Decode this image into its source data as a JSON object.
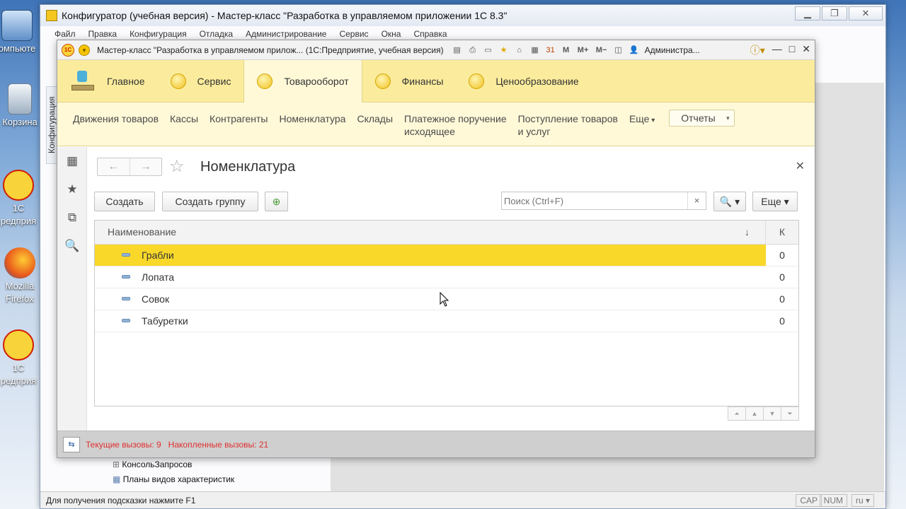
{
  "desktop": {
    "icons": [
      {
        "label": "омпьюте"
      },
      {
        "label": "Корзина"
      },
      {
        "label": "1С\nредприя"
      },
      {
        "label": "Mozilla Firefox"
      },
      {
        "label": "1С\nредприя"
      }
    ]
  },
  "configurator": {
    "title": "Конфигуратор (учебная версия) - Мастер-класс \"Разработка в управляемом приложении 1С 8.3\"",
    "menu": [
      "Файл",
      "Правка",
      "Конфигурация",
      "Отладка",
      "Администрирование",
      "Сервис",
      "Окна",
      "Справка"
    ],
    "side_tab": "Конфигурация",
    "tree": [
      "КонсольЗапросов",
      "Планы видов характеристик"
    ],
    "status_text": "Для получения подсказки нажмите F1",
    "indicators": {
      "cap": "CAP",
      "num": "NUM",
      "lang": "ru"
    }
  },
  "enterprise": {
    "title": "Мастер-класс \"Разработка в управляемом прилож...  (1С:Предприятие, учебная версия)",
    "user": "Администра...",
    "sections": [
      {
        "label": "Главное"
      },
      {
        "label": "Сервис"
      },
      {
        "label": "Товарооборот",
        "active": true
      },
      {
        "label": "Финансы"
      },
      {
        "label": "Ценообразование"
      }
    ],
    "commands": [
      {
        "label": "Движения товаров"
      },
      {
        "label": "Кассы"
      },
      {
        "label": "Контрагенты"
      },
      {
        "label": "Номенклатура"
      },
      {
        "label": "Склады"
      },
      {
        "label": "Платежное поручение\nисходящее"
      },
      {
        "label": "Поступление товаров\nи услуг"
      }
    ],
    "more_label": "Еще",
    "reports_label": "Отчеты",
    "form": {
      "title": "Номенклатура",
      "create_label": "Создать",
      "create_group_label": "Создать группу",
      "search_placeholder": "Поиск (Ctrl+F)",
      "more_label": "Еще",
      "columns": {
        "name": "Наименование",
        "code": "К"
      },
      "rows": [
        {
          "name": "Грабли",
          "code": "0",
          "selected": true
        },
        {
          "name": "Лопата",
          "code": "0"
        },
        {
          "name": "Совок",
          "code": "0"
        },
        {
          "name": "Табуретки",
          "code": "0"
        }
      ]
    },
    "status_calls": "Текущие вызовы: 9   Накопленные вызовы: 21"
  },
  "colors": {
    "sections_bg": "#fbec9d",
    "selected_row": "#f9d82a",
    "status_red": "#e03030"
  }
}
